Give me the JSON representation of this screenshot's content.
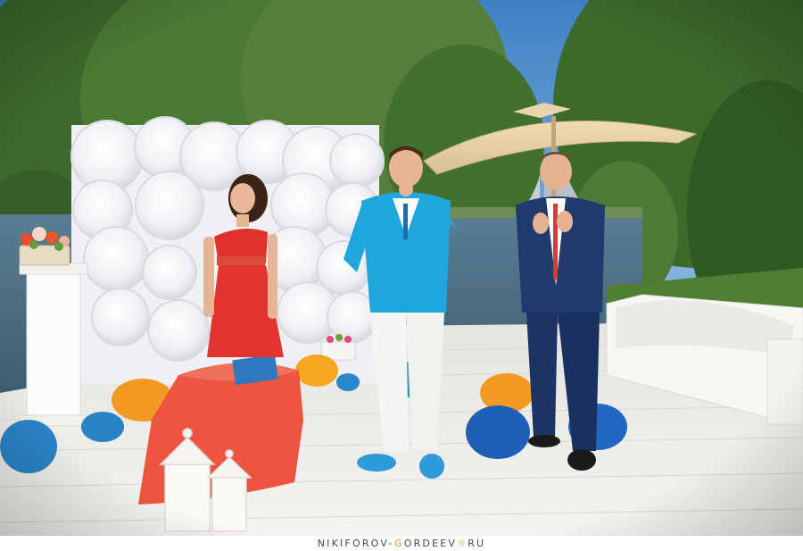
{
  "watermark": {
    "part1": "NIKIFOROV-",
    "accent1": "G",
    "part2": "ORDEEV",
    "sun_icon": "sun-icon",
    "part3": "RU"
  },
  "colors": {
    "sky": "#4f8fc9",
    "trees": "#3f6b2f",
    "water": "#4e6f86",
    "deck": "#ecebe6",
    "rose_wall": "#f4f5f7",
    "dress": "#e0322d",
    "table_cloth": "#ef5a46",
    "jacket_cyan": "#23a5dd",
    "navy_suit": "#1f3566",
    "umbrella": "#e4cfa6",
    "pom_orange": "#f7a020",
    "pom_blue": "#1f6fc0",
    "sofa": "#f7f6f3"
  }
}
